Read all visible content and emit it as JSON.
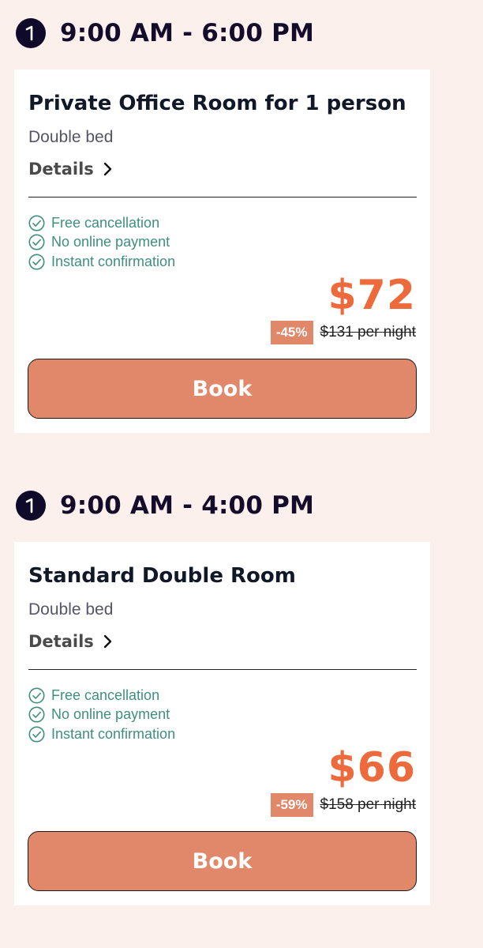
{
  "colors": {
    "background": "#fbf0eb",
    "card": "#ffffff",
    "accent_price": "#ec6a3b",
    "book_button": "#e1876a",
    "feature_green": "#3f8f7f",
    "heading_dark": "#150b2b"
  },
  "icons": {
    "clock": "clock-icon",
    "chevron": "chevron-right-icon",
    "check": "check-circle-icon"
  },
  "slots": [
    {
      "time": "9:00 AM - 6:00 PM",
      "room": {
        "title": "Private Office Room for 1 person",
        "bed": "Double bed",
        "details_label": "Details",
        "features": [
          "Free cancellation",
          "No online payment",
          "Instant confirmation"
        ],
        "price": "$72",
        "discount": "-45%",
        "old_price": "$131 per night",
        "book_label": "Book"
      }
    },
    {
      "time": "9:00 AM - 4:00 PM",
      "room": {
        "title": "Standard Double Room",
        "bed": "Double bed",
        "details_label": "Details",
        "features": [
          "Free cancellation",
          "No online payment",
          "Instant confirmation"
        ],
        "price": "$66",
        "discount": "-59%",
        "old_price": "$158 per night",
        "book_label": "Book"
      }
    }
  ]
}
